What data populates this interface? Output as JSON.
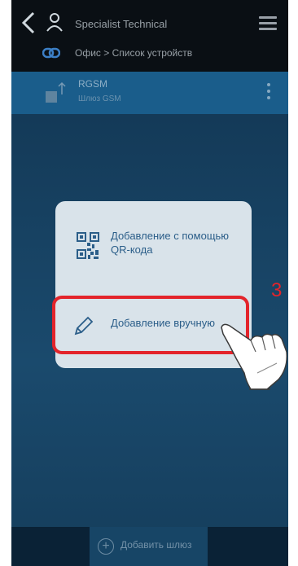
{
  "header": {
    "app_title": "Specialist Technical",
    "breadcrumb": "Офис > Список устройств"
  },
  "device": {
    "name": "RGSM",
    "subtitle": "Шлюз GSM"
  },
  "dialog": {
    "option_qr": {
      "label": "Добавление с помощью QR-кода",
      "icon": "qr-code-icon"
    },
    "option_manual": {
      "label": "Добавление вручную",
      "icon": "pencil-icon"
    }
  },
  "footer": {
    "add_gateway_label": "Добавить шлюз"
  },
  "annotation": {
    "step_number": "3",
    "color": "#e3242b"
  },
  "colors": {
    "topbar": "#0a0f14",
    "device_row": "#1a5d8b",
    "sheet": "#d9e3ea",
    "accent_text": "#2b5e89"
  }
}
